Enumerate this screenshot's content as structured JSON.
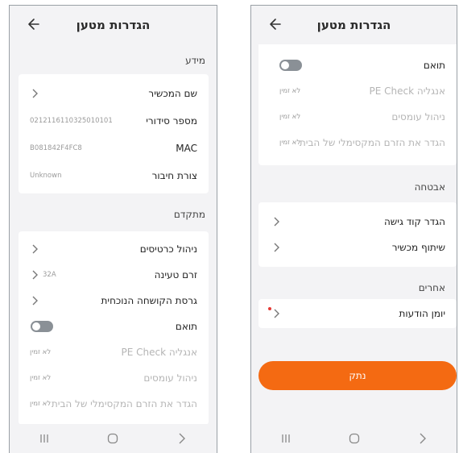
{
  "left_screen": {
    "title": "הגדרות מטען",
    "info_section": {
      "label": "מידע",
      "rows": [
        {
          "label": "שם המכשיר",
          "value": ""
        },
        {
          "label": "מספר סידורי",
          "value": "0212116110325010101"
        },
        {
          "label": "MAC",
          "value": "B081842F4FC8"
        },
        {
          "label": "צורת חיבור",
          "value": "Unknown"
        }
      ]
    },
    "advanced_section": {
      "label": "מתקדם",
      "rows": [
        {
          "label": "ניהול כרטיסים",
          "value": ""
        },
        {
          "label": "זרם טעינה",
          "value": "32A"
        },
        {
          "label": "גרסת הקושחה הנוכחית",
          "value": ""
        },
        {
          "label": "תואם",
          "value": ""
        },
        {
          "label": "אנגליה PE Check",
          "value": "לא זמין"
        },
        {
          "label": "ניהול עומסים",
          "value": "לא זמין"
        },
        {
          "label": "הגדר את הזרם המקסימלי של הבית",
          "value": "לא זמין"
        }
      ]
    },
    "compatible_toggle": "off"
  },
  "right_screen": {
    "title": "הגדרות מטען",
    "top_card_rows": [
      {
        "label": "תואם",
        "value": ""
      },
      {
        "label": "אנגליה PE Check",
        "value": "לא זמין"
      },
      {
        "label": "ניהול עומסים",
        "value": "לא זמין"
      },
      {
        "label": "הגדר את הזרם המקסימלי של הבית",
        "value": "לא זמין"
      }
    ],
    "security_section": {
      "label": "אבטחה",
      "rows": [
        {
          "label": "הגדר קוד גישה"
        },
        {
          "label": "שיתוף מכשיר"
        }
      ]
    },
    "others_section": {
      "label": "אחרים",
      "rows": [
        {
          "label": "יומן הודעות"
        }
      ]
    },
    "save_label": "נתק",
    "compatible_toggle": "off"
  },
  "colors": {
    "accent": "#f46a12",
    "background": "#f3f3f5",
    "toggle_off": "#8a9096",
    "notification_dot": "#e53935"
  },
  "icons": {
    "back": "arrow-left-icon",
    "chevron": "chevron-right-icon",
    "nav_recent": "recent-apps-icon",
    "nav_home": "home-icon",
    "nav_back": "nav-back-icon"
  }
}
